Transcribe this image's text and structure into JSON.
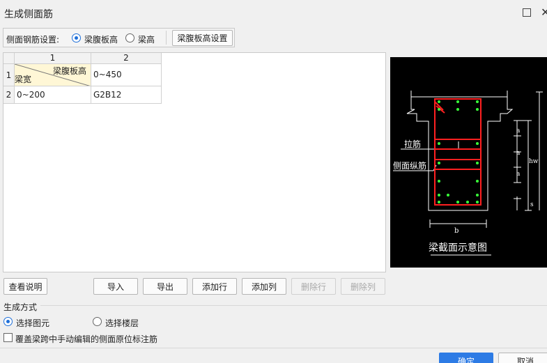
{
  "window": {
    "title": "生成侧面筋"
  },
  "settings": {
    "label": "侧面钢筋设置:",
    "options": [
      {
        "label": "梁腹板高",
        "checked": true
      },
      {
        "label": "梁高",
        "checked": false
      }
    ],
    "config_button": "梁腹板高设置"
  },
  "grid": {
    "col_headers": [
      "1",
      "2"
    ],
    "row_headers": [
      "1",
      "2"
    ],
    "corner_top": "梁腹板高",
    "corner_bottom": "梁宽",
    "header_value": "0~450",
    "row2_width": "0~200",
    "row2_value": "G2B12"
  },
  "diagram": {
    "label_tie": "拉筋",
    "label_side": "侧面纵筋",
    "label_a": "a",
    "label_hw": "hw",
    "label_s": "s",
    "label_b": "b",
    "caption": "梁截面示意图"
  },
  "buttons": {
    "help": "查看说明",
    "import": "导入",
    "export": "导出",
    "add_row": "添加行",
    "add_col": "添加列",
    "del_row": "删除行",
    "del_col": "删除列",
    "ok": "确定",
    "cancel": "取消"
  },
  "generate": {
    "section": "生成方式",
    "options": [
      {
        "label": "选择图元",
        "checked": true
      },
      {
        "label": "选择楼层",
        "checked": false
      }
    ],
    "override_label": "覆盖梁跨中手动编辑的侧面原位标注筋",
    "override_checked": false
  }
}
